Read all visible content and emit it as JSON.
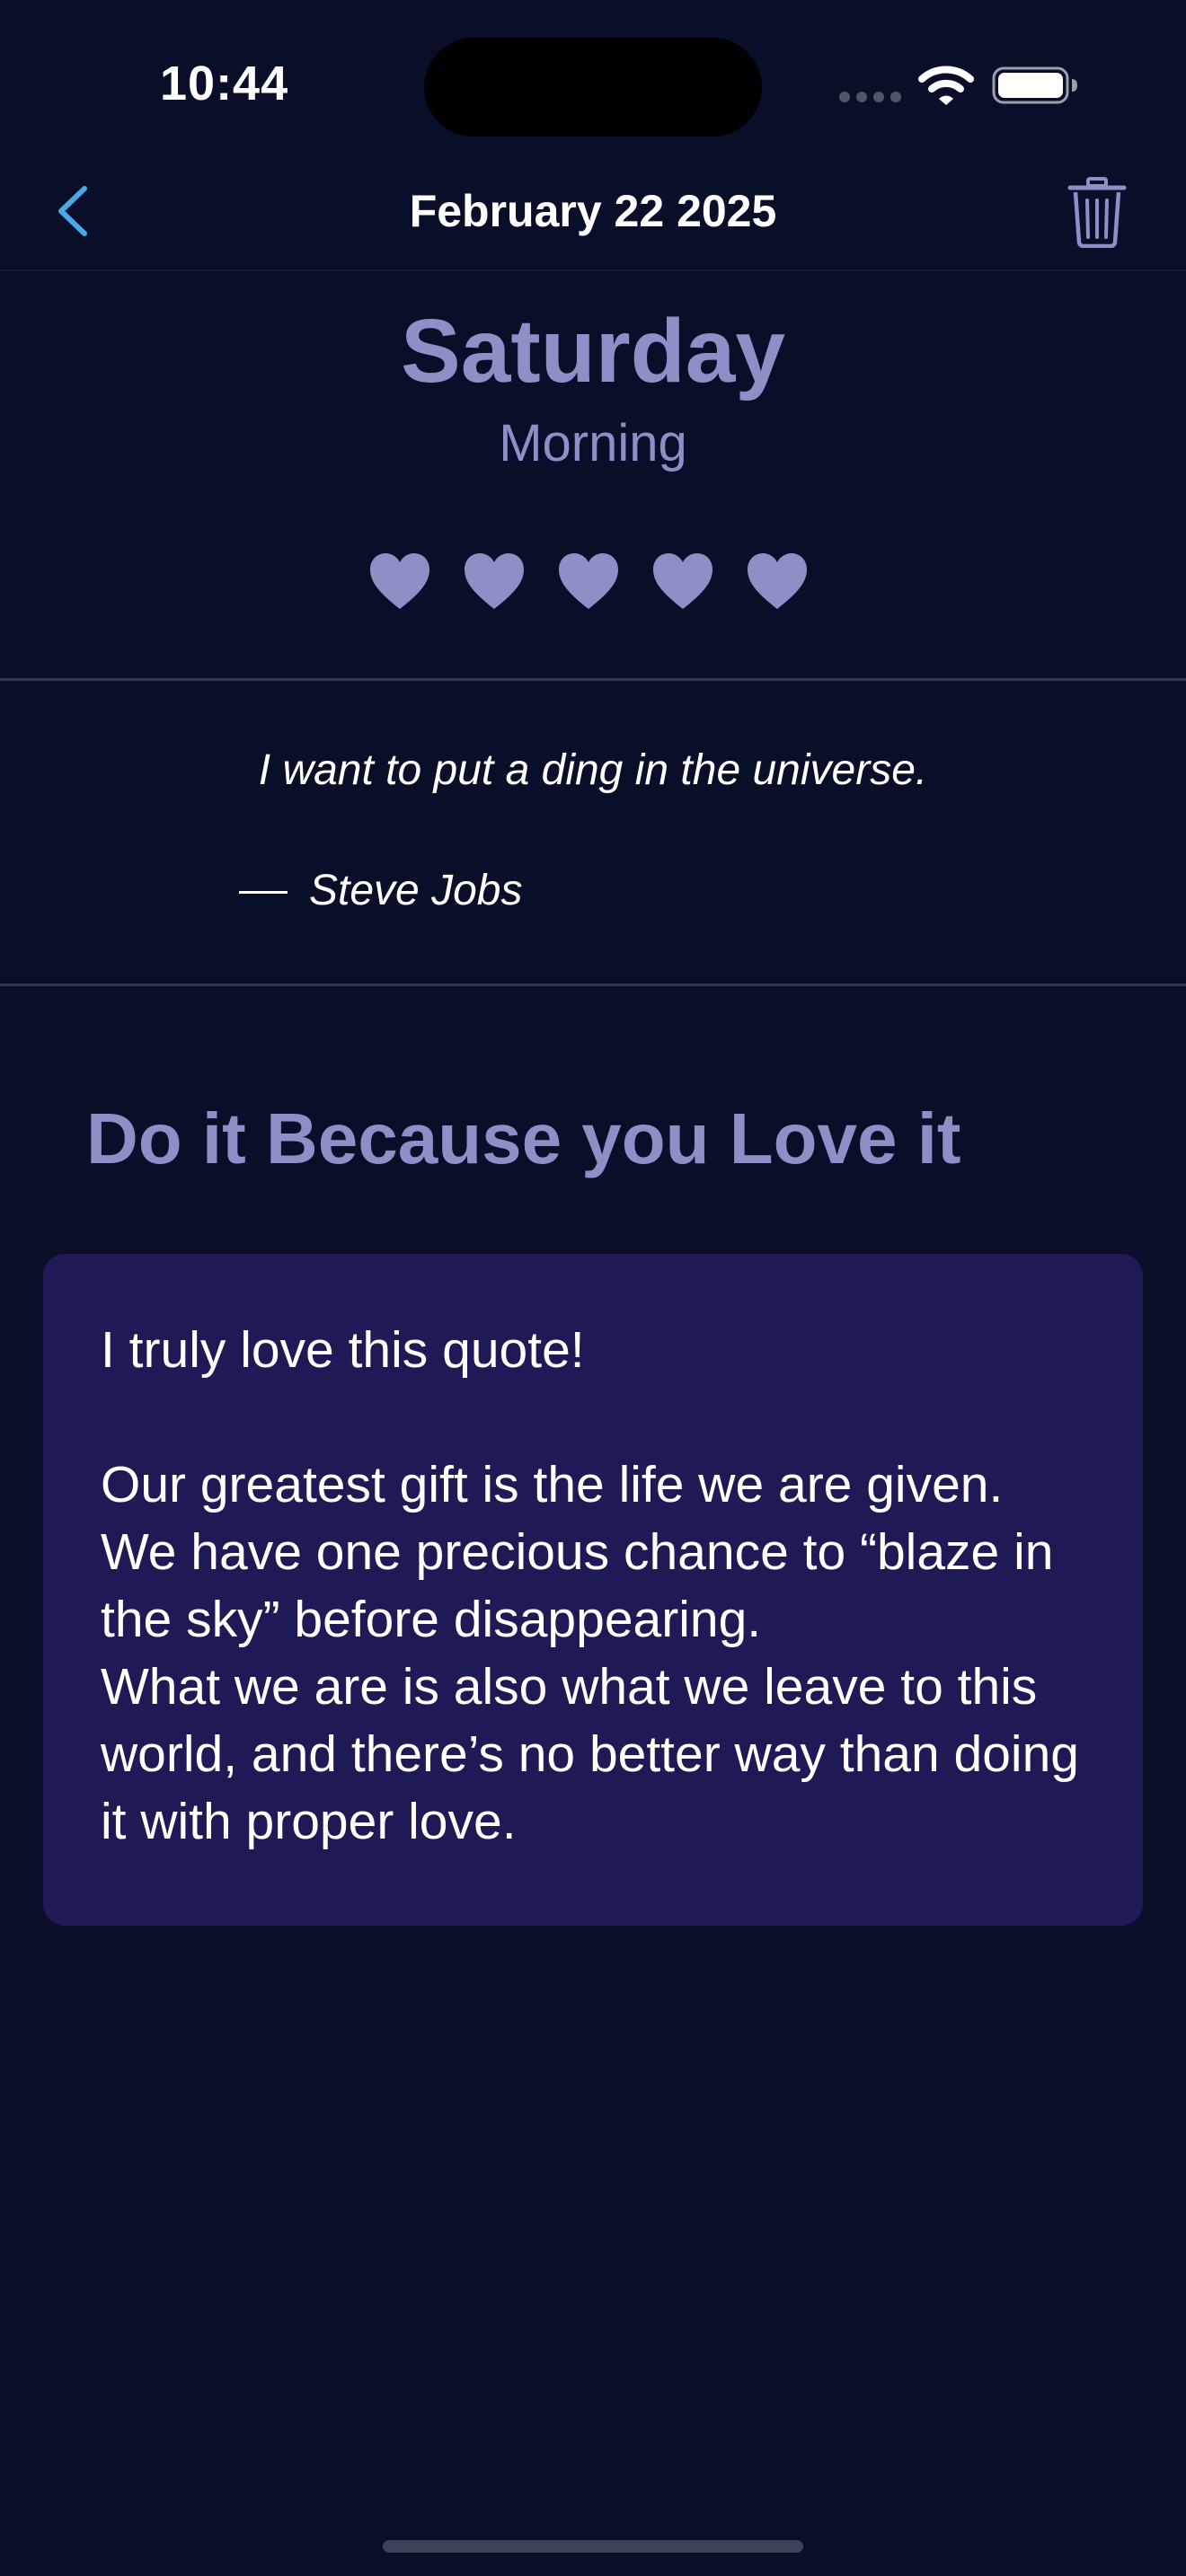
{
  "status_bar": {
    "time": "10:44"
  },
  "nav": {
    "title": "February 22 2025",
    "back_icon": "chevron-left-icon",
    "trash_icon": "trash-icon"
  },
  "header": {
    "day": "Saturday",
    "period": "Morning",
    "rating": {
      "value": 5,
      "max": 5,
      "icon": "heart-icon"
    }
  },
  "quote": {
    "text": "I want to put a ding in the universe.",
    "author": "Steve Jobs"
  },
  "entry": {
    "title": "Do it Because you Love it",
    "body": "I truly love this quote!\n\nOur greatest gift is the life we are given.\nWe have one precious chance to “blaze in the sky” before disappearing.\nWhat we are is also what we leave to this world, and there’s no better way than doing it with proper love."
  },
  "colors": {
    "background": "#090f29",
    "accent": "#8f8fc8",
    "card": "#1f1a55",
    "back_button": "#4aa8e6"
  }
}
